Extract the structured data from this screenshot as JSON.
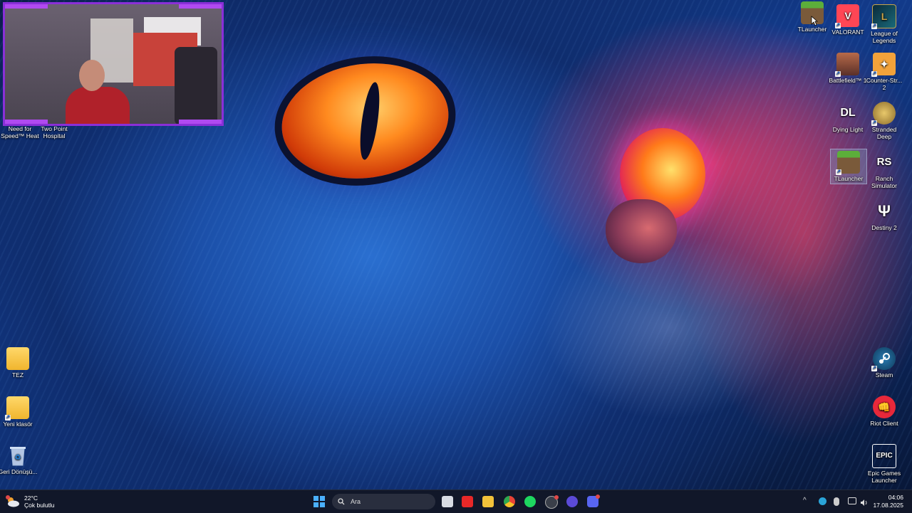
{
  "desktop": {
    "left_icons_top": [
      {
        "name": "need-for-speed-heat",
        "label": "Need for Speed™ Heat"
      },
      {
        "name": "two-point-hospital",
        "label": "Two Point Hospital"
      }
    ],
    "left_icons_bottom": [
      {
        "name": "tez-folder",
        "label": "TEZ"
      },
      {
        "name": "yeni-klasor-folder",
        "label": "Yeni klasör"
      },
      {
        "name": "recycle-bin",
        "label": "Geri Dönüşü..."
      }
    ],
    "right_icons": [
      {
        "name": "tlauncher-top",
        "label": "TLauncher"
      },
      {
        "name": "valorant",
        "label": "VALORANT"
      },
      {
        "name": "league-of-legends",
        "label": "League of Legends"
      },
      {
        "name": "battlefield-1",
        "label": "Battlefield™ 1"
      },
      {
        "name": "counter-strike-2",
        "label": "Counter-Str... 2"
      },
      {
        "name": "dying-light",
        "label": "Dying Light"
      },
      {
        "name": "stranded-deep",
        "label": "Stranded Deep"
      },
      {
        "name": "tlauncher-selected",
        "label": "TLauncher"
      },
      {
        "name": "ranch-simulator",
        "label": "Ranch Simulator"
      },
      {
        "name": "destiny-2",
        "label": "Destiny 2"
      },
      {
        "name": "steam",
        "label": "Steam"
      },
      {
        "name": "riot-client",
        "label": "Riot Client"
      },
      {
        "name": "epic-games-launcher",
        "label": "Epic Games Launcher"
      }
    ],
    "icon_glyphs": {
      "dying_light": "DL",
      "ranch_simulator": "RS",
      "epic_games": "EPIC",
      "riot_client": "👊",
      "destiny": "Ψ"
    }
  },
  "taskbar": {
    "weather_temp": "22°C",
    "weather_desc": "Çok bulutlu",
    "search_placeholder": "Ara",
    "time": "04:06",
    "date": "17.08.2025",
    "tray_chevron": "^"
  },
  "colors": {
    "accent": "#8a2fd8",
    "windows_blue": "#4ab0ff"
  }
}
